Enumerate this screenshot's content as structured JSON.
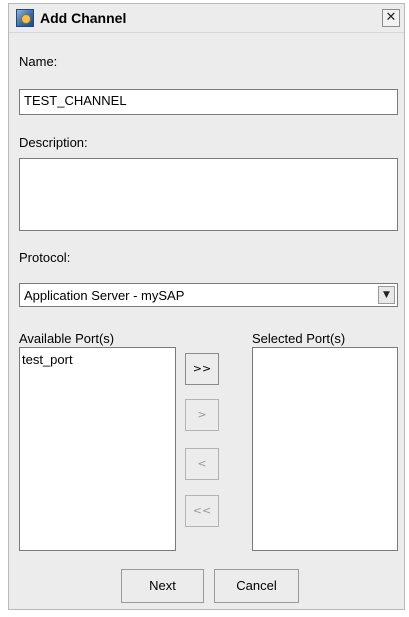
{
  "window": {
    "title": "Add Channel",
    "close_glyph": "✕",
    "icon": "channel-app-icon"
  },
  "form": {
    "name_label": "Name:",
    "name_value": "TEST_CHANNEL",
    "description_label": "Description:",
    "description_value": "",
    "protocol_label": "Protocol:",
    "protocol_selected": "Application Server - mySAP",
    "dropdown_glyph": "▼"
  },
  "ports": {
    "available_label": "Available Port(s)",
    "selected_label": "Selected Port(s)",
    "available_items": [
      "test_port"
    ],
    "selected_items": [],
    "move_all_right": ">>",
    "move_right": ">",
    "move_left": "<",
    "move_all_left": "<<"
  },
  "buttons": {
    "next": "Next",
    "cancel": "Cancel"
  }
}
